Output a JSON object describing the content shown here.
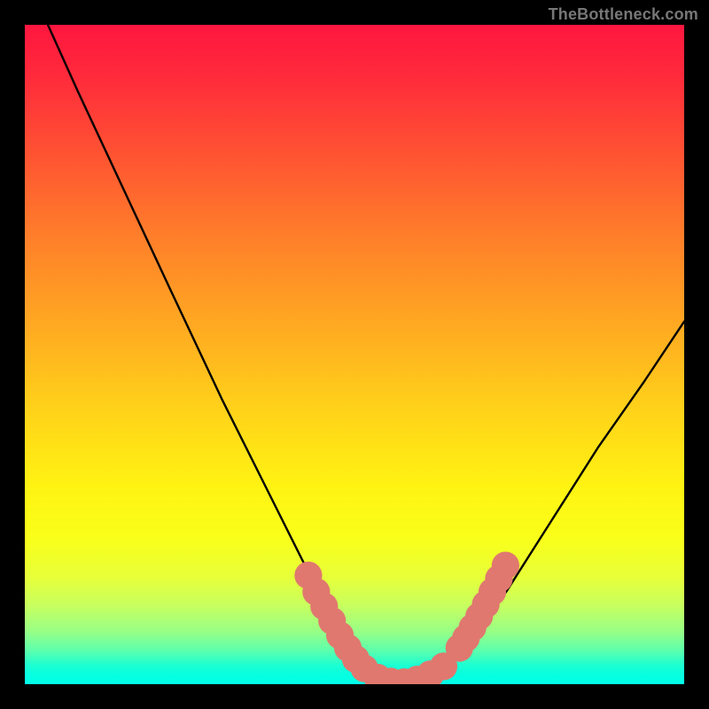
{
  "watermark": {
    "text": "TheBottleneck.com"
  },
  "chart_data": {
    "type": "line",
    "title": "",
    "xlabel": "",
    "ylabel": "",
    "xlim": [
      0,
      100
    ],
    "ylim": [
      0,
      100
    ],
    "grid": false,
    "legend": false,
    "background_gradient": {
      "top": "#ff163f",
      "mid": "#ffe013",
      "bottom": "#00ffe0"
    },
    "series": [
      {
        "name": "bottleneck-curve",
        "color": "#000000",
        "x": [
          3.5,
          8,
          15,
          22,
          30,
          38,
          44,
          49,
          52,
          55,
          58,
          63,
          67,
          73,
          80,
          87,
          94,
          100
        ],
        "y": [
          100,
          90,
          75,
          60,
          43,
          27,
          15,
          6,
          2,
          0,
          0,
          2,
          6,
          14,
          25,
          36,
          46,
          55
        ]
      }
    ],
    "markers": [
      {
        "name": "highlight-dots",
        "color": "#e0786f",
        "radius": 2.1,
        "x": [
          43.0,
          44.2,
          45.4,
          46.6,
          47.8,
          49.0,
          50.2,
          51.5,
          53.5,
          55.5,
          57.5,
          59.5,
          61.5,
          63.5,
          65.9,
          66.9,
          67.9,
          68.9,
          69.9,
          70.9,
          71.9,
          72.9
        ],
        "y": [
          16.5,
          14.0,
          11.8,
          9.6,
          7.4,
          5.5,
          3.8,
          2.4,
          1.0,
          0.4,
          0.3,
          0.7,
          1.5,
          2.7,
          5.5,
          7.0,
          8.6,
          10.3,
          12.1,
          14.0,
          16.0,
          18.0
        ]
      }
    ]
  }
}
